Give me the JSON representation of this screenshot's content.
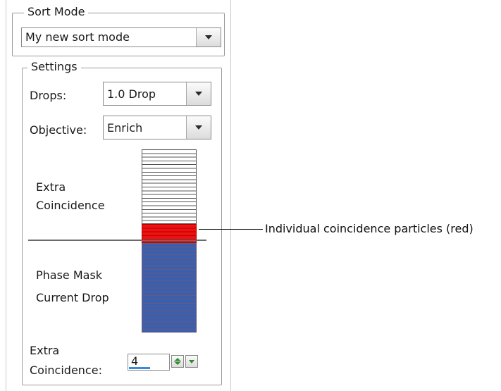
{
  "sort_mode": {
    "legend": "Sort Mode",
    "selected": "My new sort mode"
  },
  "settings": {
    "legend": "Settings",
    "drops_label": "Drops:",
    "drops_value": "1.0 Drop",
    "objective_label": "Objective:",
    "objective_value": "Enrich",
    "extra_label_line1": "Extra",
    "extra_label_line2": "Coincidence",
    "phase_label_line1": "Phase Mask",
    "phase_label_line2": "Current Drop",
    "bottom_label_line1": "Extra",
    "bottom_label_line2": "Coincidence:",
    "extra_coincidence_value": "4"
  },
  "diagram": {
    "white_rows": 20,
    "red_rows": 5,
    "blue_rows": 24,
    "colors": {
      "white_fill": "#ffffff",
      "white_line": "#555555",
      "red_fill": "#ee1111",
      "red_line": "#b30000",
      "blue_fill": "#3a5fae",
      "blue_line": "#6a5a7a",
      "divider": "#6b6b6b"
    }
  },
  "callout": {
    "text": "Individual coincidence particles (red)"
  },
  "icons": {
    "dropdown": "chevron-down-icon",
    "spin": "spin-updown-icon"
  }
}
